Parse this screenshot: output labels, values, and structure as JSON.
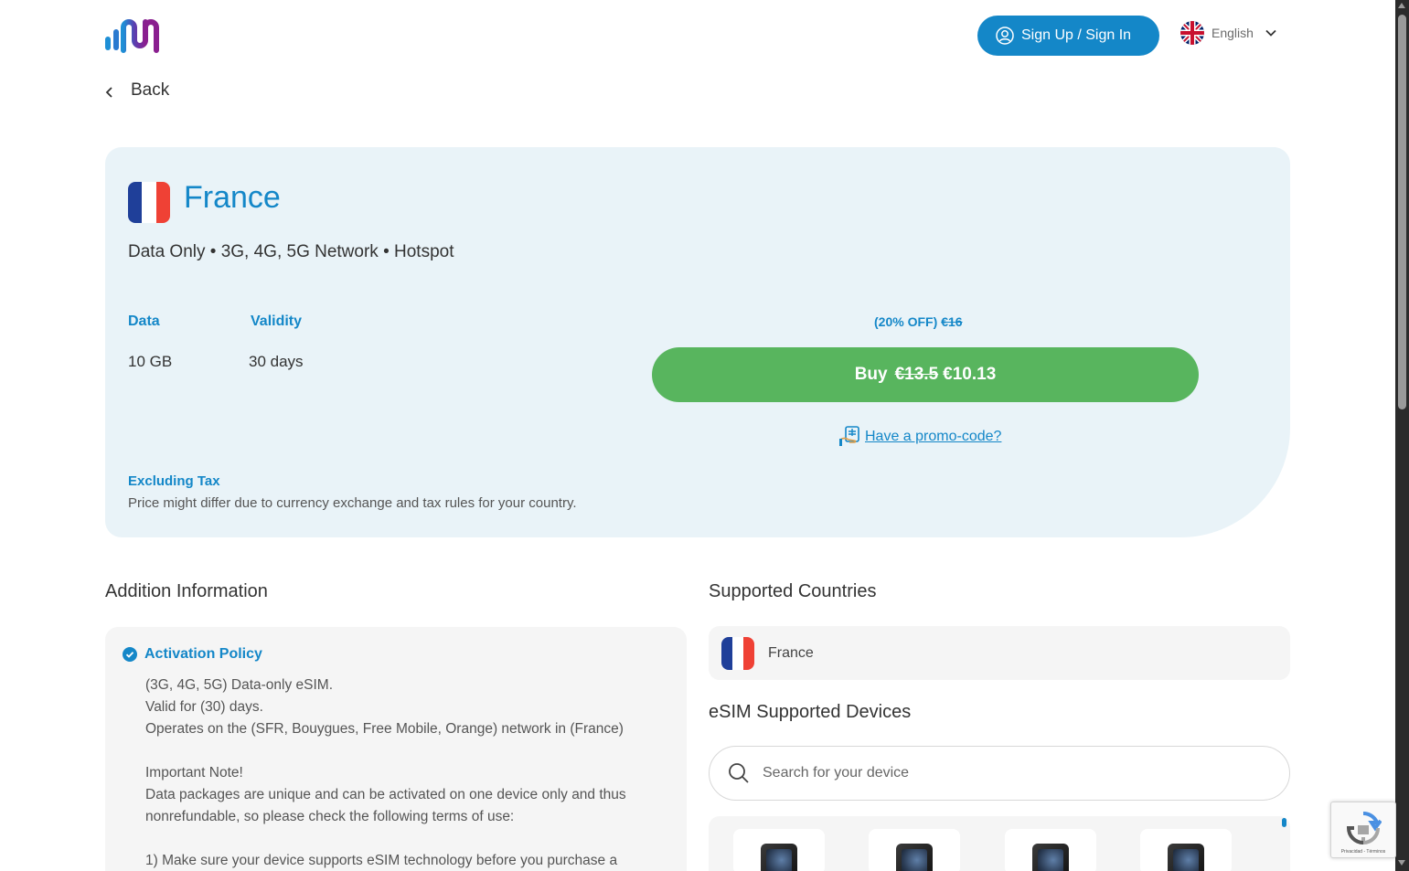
{
  "header": {
    "signin_label": "Sign Up / Sign In",
    "language": "English"
  },
  "nav": {
    "back_label": "Back"
  },
  "plan": {
    "country": "France",
    "features": "Data Only • 3G, 4G, 5G Network • Hotspot",
    "data_label": "Data",
    "data_value": "10 GB",
    "validity_label": "Validity",
    "validity_value": "30 days",
    "discount_text": "(20% OFF)",
    "discount_original": "€16",
    "buy_label": "Buy",
    "buy_old_price": "€13.5",
    "buy_new_price": "€10.13",
    "promo_label": "Have a promo-code?",
    "tax_title": "Excluding Tax",
    "tax_note": "Price might differ due to currency exchange and tax rules for your country."
  },
  "additional": {
    "heading": "Addition Information",
    "policy_title": "Activation Policy",
    "lines": [
      "(3G, 4G, 5G) Data-only eSIM.",
      "Valid for (30) days.",
      "Operates on the (SFR, Bouygues, Free Mobile, Orange) network in (France)",
      "",
      "Important Note!",
      "Data packages are unique and can be activated on one device only and thus",
      "nonrefundable, so please check the following terms of use:",
      "",
      "1) Make sure your device supports eSIM technology before you purchase a"
    ]
  },
  "supported": {
    "heading": "Supported Countries",
    "countries": [
      "France"
    ],
    "devices_heading": "eSIM Supported Devices",
    "search_placeholder": "Search for your device"
  },
  "recaptcha": {
    "text": "Privacidad - Términos"
  },
  "colors": {
    "brand_blue": "#1487c8",
    "buy_green": "#58b55e",
    "card_bg": "#e9f3f8"
  }
}
